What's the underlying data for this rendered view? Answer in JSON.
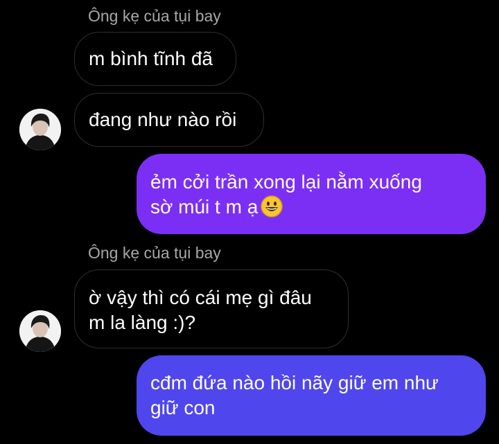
{
  "conversation": {
    "groups": [
      {
        "sender": "Ông kẹ của tụi bay",
        "messages": [
          {
            "text": "m bình tĩnh đã"
          },
          {
            "text": "đang như nào rồi"
          }
        ]
      },
      {
        "direction": "outgoing",
        "lines": [
          "ẻm cởi trần xong lại nằm xuống",
          "sờ múi t m ạ"
        ],
        "emoji": "grinning-face-emoji"
      },
      {
        "sender": "Ông kẹ của tụi bay",
        "messages": [
          {
            "lines": [
              "ờ vậy thì có cái mẹ gì đâu",
              "m la làng :)?"
            ]
          }
        ]
      },
      {
        "direction": "outgoing",
        "lines": [
          "cđm đứa nào hồi nãy giữ em như",
          "giữ con"
        ]
      }
    ]
  },
  "colors": {
    "background": "#000000",
    "incoming_border": "#2f2f2f",
    "sender_name": "#a8a8a8",
    "outgoing_1": "#7b2ff5",
    "outgoing_2": "#5046ee"
  }
}
